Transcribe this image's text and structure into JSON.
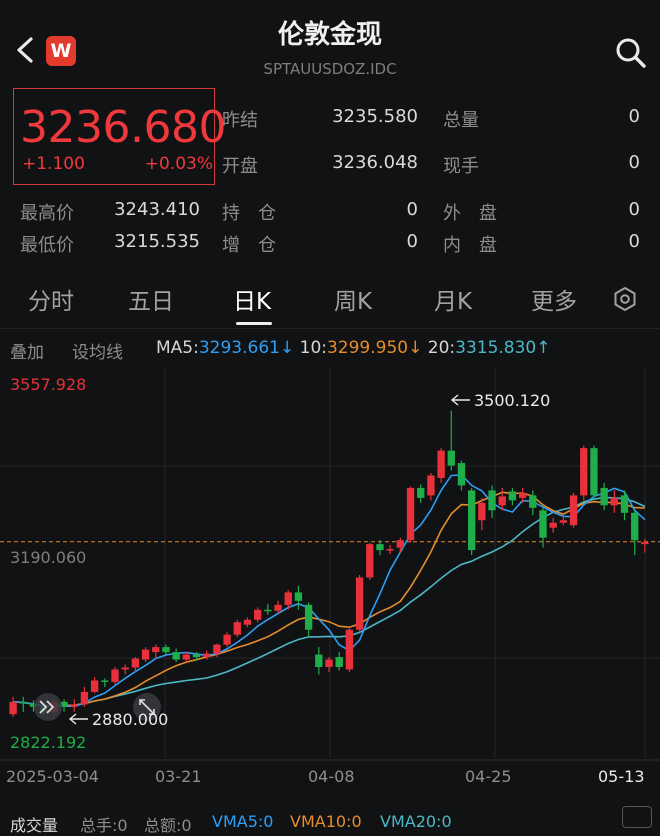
{
  "header": {
    "title": "伦敦金现",
    "subtitle": "SPTAUUSDOZ.IDC",
    "logo_letter": "W"
  },
  "quote": {
    "price": "3236.680",
    "change": "+1.100",
    "change_pct": "+0.03%",
    "fields": [
      {
        "label": "昨结",
        "value": "3235.580"
      },
      {
        "label": "总量",
        "value": "0"
      },
      {
        "label": "开盘",
        "value": "3236.048"
      },
      {
        "label": "现手",
        "value": "0"
      },
      {
        "label": "最高价",
        "value": "3243.410"
      },
      {
        "label": "持　仓",
        "value": "0"
      },
      {
        "label": "外　盘",
        "value": "0"
      },
      {
        "label": "最低价",
        "value": "3215.535"
      },
      {
        "label": "增　仓",
        "value": "0"
      },
      {
        "label": "内　盘",
        "value": "0"
      }
    ]
  },
  "tabs": [
    "分时",
    "五日",
    "日K",
    "周K",
    "月K",
    "更多"
  ],
  "active_tab": "日K",
  "indicator_bar": {
    "overlay": "叠加",
    "set_ma": "设均线",
    "ma5_label": "MA5:",
    "ma5_value": "3293.661",
    "ma5_arrow": "↓",
    "ma10_label": "10:",
    "ma10_value": "3299.950",
    "ma10_arrow": "↓",
    "ma20_label": "20:",
    "ma20_value": "3315.830",
    "ma20_arrow": "↑"
  },
  "chart_data": {
    "type": "candlestick",
    "y_top_label": "3557.928",
    "y_bottom_label": "2822.192",
    "y_mid_label": "3190.060",
    "ylim": [
      2822.192,
      3557.928
    ],
    "current_price_line": 3236.68,
    "max_annotation": "3500.120",
    "min_annotation": "2880.000",
    "x_labels": [
      "2025-03-04",
      "03-21",
      "04-08",
      "04-25",
      "05-13"
    ],
    "colors": {
      "up": "#e8313a",
      "down": "#1fae4a",
      "ma5": "#2f9ef5",
      "ma10": "#e58d2b",
      "ma20": "#4bb8c7",
      "price_line": "#e88a2a"
    },
    "candles": [
      [
        2915,
        2890,
        2925,
        2885
      ],
      [
        2912,
        2915,
        2925,
        2895
      ],
      [
        2905,
        2912,
        2918,
        2895
      ],
      [
        2895,
        2905,
        2912,
        2888
      ],
      [
        2915,
        2895,
        2920,
        2880
      ],
      [
        2905,
        2915,
        2920,
        2895
      ],
      [
        2910,
        2905,
        2920,
        2895
      ],
      [
        2935,
        2910,
        2945,
        2905
      ],
      [
        2958,
        2935,
        2965,
        2932
      ],
      [
        2955,
        2958,
        2962,
        2945
      ],
      [
        2980,
        2955,
        2985,
        2950
      ],
      [
        2984,
        2980,
        2990,
        2970
      ],
      [
        3002,
        2984,
        3005,
        2975
      ],
      [
        3020,
        3000,
        3025,
        2995
      ],
      [
        3025,
        3015,
        3030,
        3000
      ],
      [
        3015,
        3025,
        3030,
        3010
      ],
      [
        3000,
        3015,
        3022,
        2995
      ],
      [
        3010,
        3000,
        3015,
        2995
      ],
      [
        3005,
        3010,
        3015,
        2998
      ],
      [
        3012,
        3005,
        3018,
        3000
      ],
      [
        3030,
        3012,
        3032,
        3005
      ],
      [
        3050,
        3030,
        3055,
        3025
      ],
      [
        3075,
        3050,
        3080,
        3045
      ],
      [
        3080,
        3070,
        3085,
        3065
      ],
      [
        3100,
        3080,
        3105,
        3075
      ],
      [
        3098,
        3100,
        3112,
        3090
      ],
      [
        3110,
        3098,
        3118,
        3092
      ],
      [
        3135,
        3110,
        3140,
        3100
      ],
      [
        3118,
        3135,
        3148,
        3100
      ],
      [
        3060,
        3110,
        3115,
        3045
      ],
      [
        2985,
        3010,
        3025,
        2970
      ],
      [
        3000,
        2985,
        3005,
        2975
      ],
      [
        2985,
        3005,
        3015,
        2978
      ],
      [
        3060,
        2980,
        3065,
        2975
      ],
      [
        3165,
        3060,
        3170,
        3055
      ],
      [
        3232,
        3165,
        3235,
        3160
      ],
      [
        3220,
        3232,
        3240,
        3210
      ],
      [
        3222,
        3220,
        3230,
        3212
      ],
      [
        3240,
        3225,
        3245,
        3215
      ],
      [
        3345,
        3240,
        3348,
        3235
      ],
      [
        3325,
        3345,
        3352,
        3315
      ],
      [
        3370,
        3330,
        3375,
        3320
      ],
      [
        3420,
        3365,
        3425,
        3355
      ],
      [
        3390,
        3420,
        3500,
        3380
      ],
      [
        3350,
        3395,
        3400,
        3340
      ],
      [
        3220,
        3340,
        3345,
        3210
      ],
      [
        3315,
        3280,
        3325,
        3260
      ],
      [
        3300,
        3340,
        3350,
        3285
      ],
      [
        3328,
        3310,
        3345,
        3300
      ],
      [
        3320,
        3338,
        3345,
        3310
      ],
      [
        3335,
        3325,
        3345,
        3315
      ],
      [
        3305,
        3330,
        3340,
        3290
      ],
      [
        3245,
        3300,
        3305,
        3225
      ],
      [
        3275,
        3265,
        3285,
        3255
      ],
      [
        3280,
        3275,
        3290,
        3270
      ],
      [
        3330,
        3270,
        3335,
        3265
      ],
      [
        3425,
        3330,
        3430,
        3320
      ],
      [
        3330,
        3425,
        3430,
        3320
      ],
      [
        3310,
        3345,
        3355,
        3300
      ],
      [
        3325,
        3310,
        3340,
        3295
      ],
      [
        3295,
        3330,
        3340,
        3280
      ],
      [
        3240,
        3295,
        3300,
        3210
      ],
      [
        3236,
        3232,
        3243,
        3215
      ]
    ]
  },
  "volume_bar": {
    "label": "成交量",
    "total_hand": "总手:0",
    "total_amount": "总额:0",
    "vma5": "VMA5:0",
    "vma10": "VMA10:0",
    "vma20": "VMA20:0"
  }
}
